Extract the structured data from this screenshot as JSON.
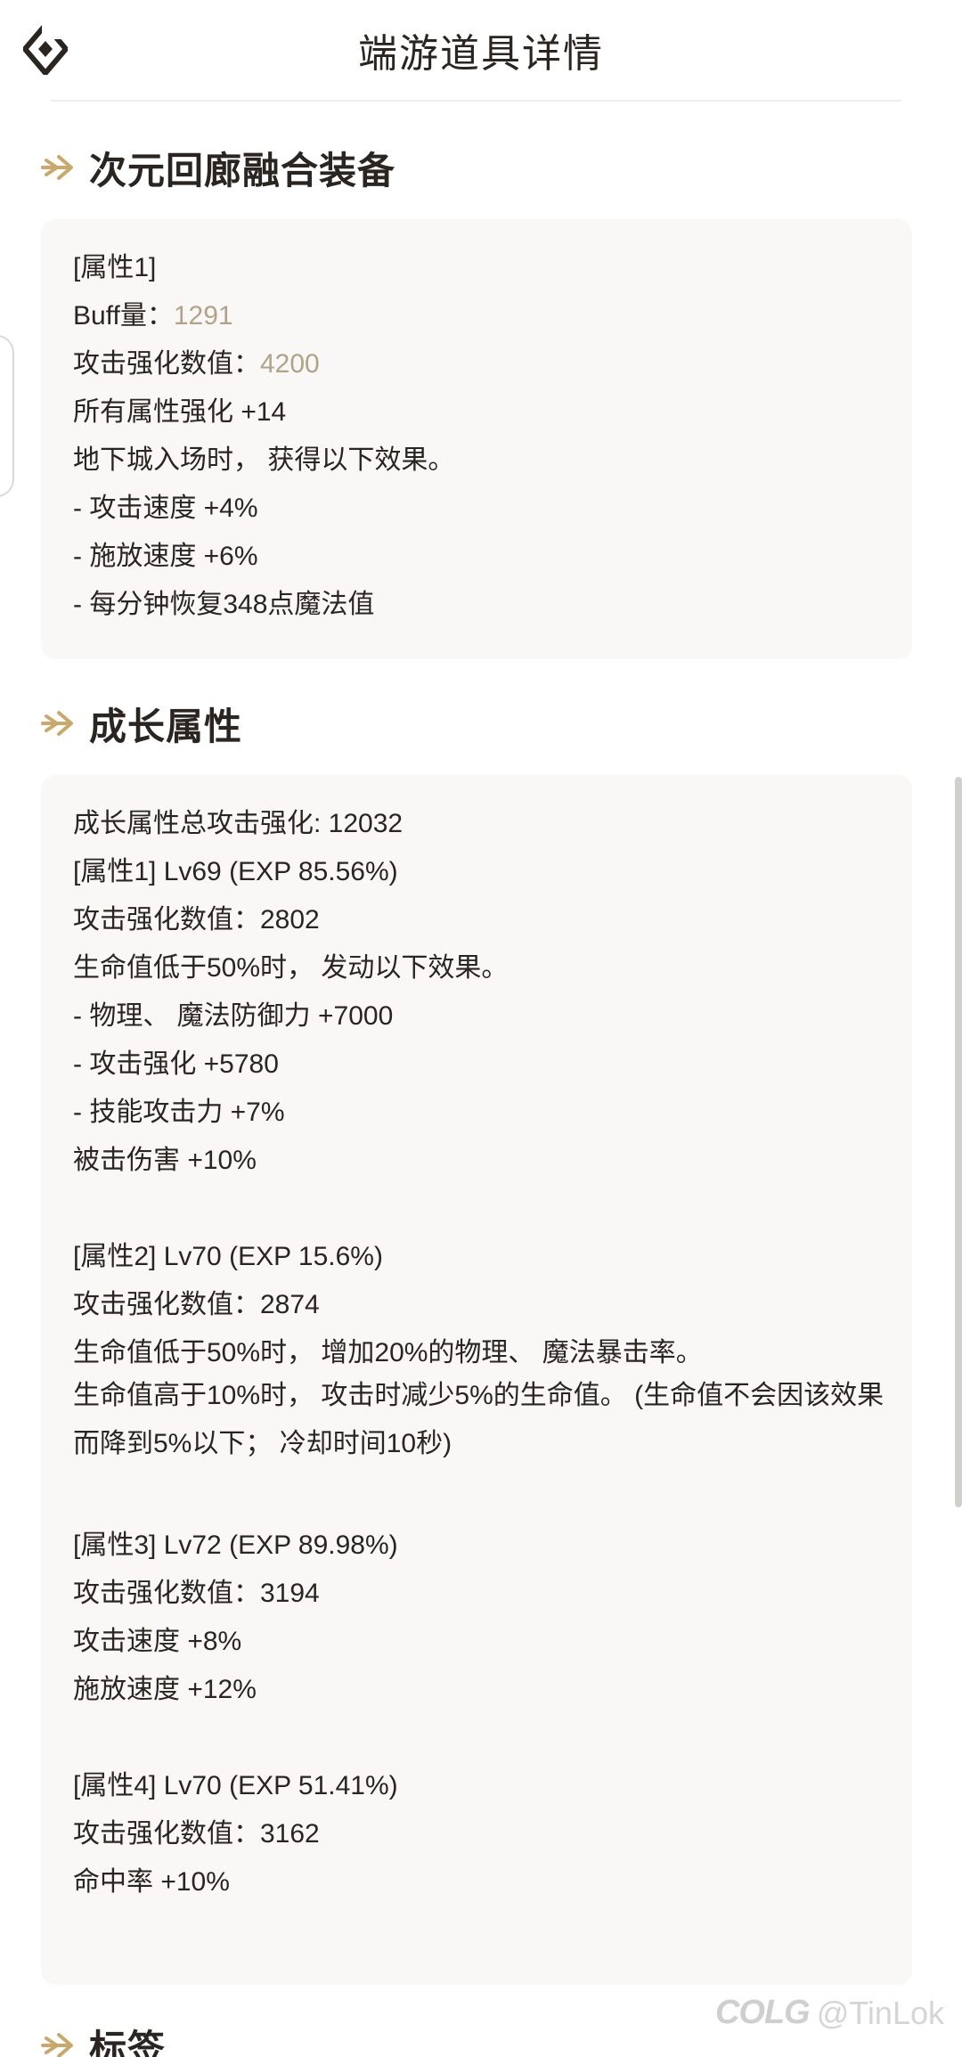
{
  "header": {
    "title": "端游道具详情",
    "logo_icon": "diamond-logo-icon"
  },
  "sections": {
    "fusion": {
      "title": "次元回廊融合装备",
      "lines": {
        "attr_label": "[属性1]",
        "buff_label": "Buff量：",
        "buff_value": "1291",
        "atk_label": "攻击强化数值：",
        "atk_value": "4200",
        "all_attr": "所有属性强化 +14",
        "dungeon": "地下城入场时， 获得以下效果。",
        "atk_speed": "- 攻击速度 +4%",
        "cast_speed": "- 施放速度 +6%",
        "mp_regen": "- 每分钟恢复348点魔法值"
      }
    },
    "growth": {
      "title": "成长属性",
      "lines": {
        "l01": "成长属性总攻击强化: 12032",
        "l02": "[属性1] Lv69 (EXP 85.56%)",
        "l03": "攻击强化数值：2802",
        "l04": "生命值低于50%时， 发动以下效果。",
        "l05": "- 物理、 魔法防御力 +7000",
        "l06": "- 攻击强化 +5780",
        "l07": "- 技能攻击力 +7%",
        "l08": "被击伤害 +10%",
        "l09": "[属性2] Lv70 (EXP 15.6%)",
        "l10": "攻击强化数值：2874",
        "l11": "生命值低于50%时， 增加20%的物理、 魔法暴击率。",
        "l12": "生命值高于10%时， 攻击时减少5%的生命值。 (生命值不会因该效果而降到5%以下； 冷却时间10秒)",
        "l13": "[属性3] Lv72 (EXP 89.98%)",
        "l14": "攻击强化数值：3194",
        "l15": "攻击速度 +8%",
        "l16": "施放速度 +12%",
        "l17": "[属性4] Lv70 (EXP 51.41%)",
        "l18": "攻击强化数值：3162",
        "l19": "命中率 +10%"
      }
    },
    "tags": {
      "title": "标签"
    }
  },
  "watermark": {
    "brand": "COLG",
    "user": "@TinLok"
  },
  "colors": {
    "accent": "#c9a96a",
    "muted_value": "#b1a288",
    "card_bg": "#f9f8f7",
    "text": "#2a2520"
  }
}
